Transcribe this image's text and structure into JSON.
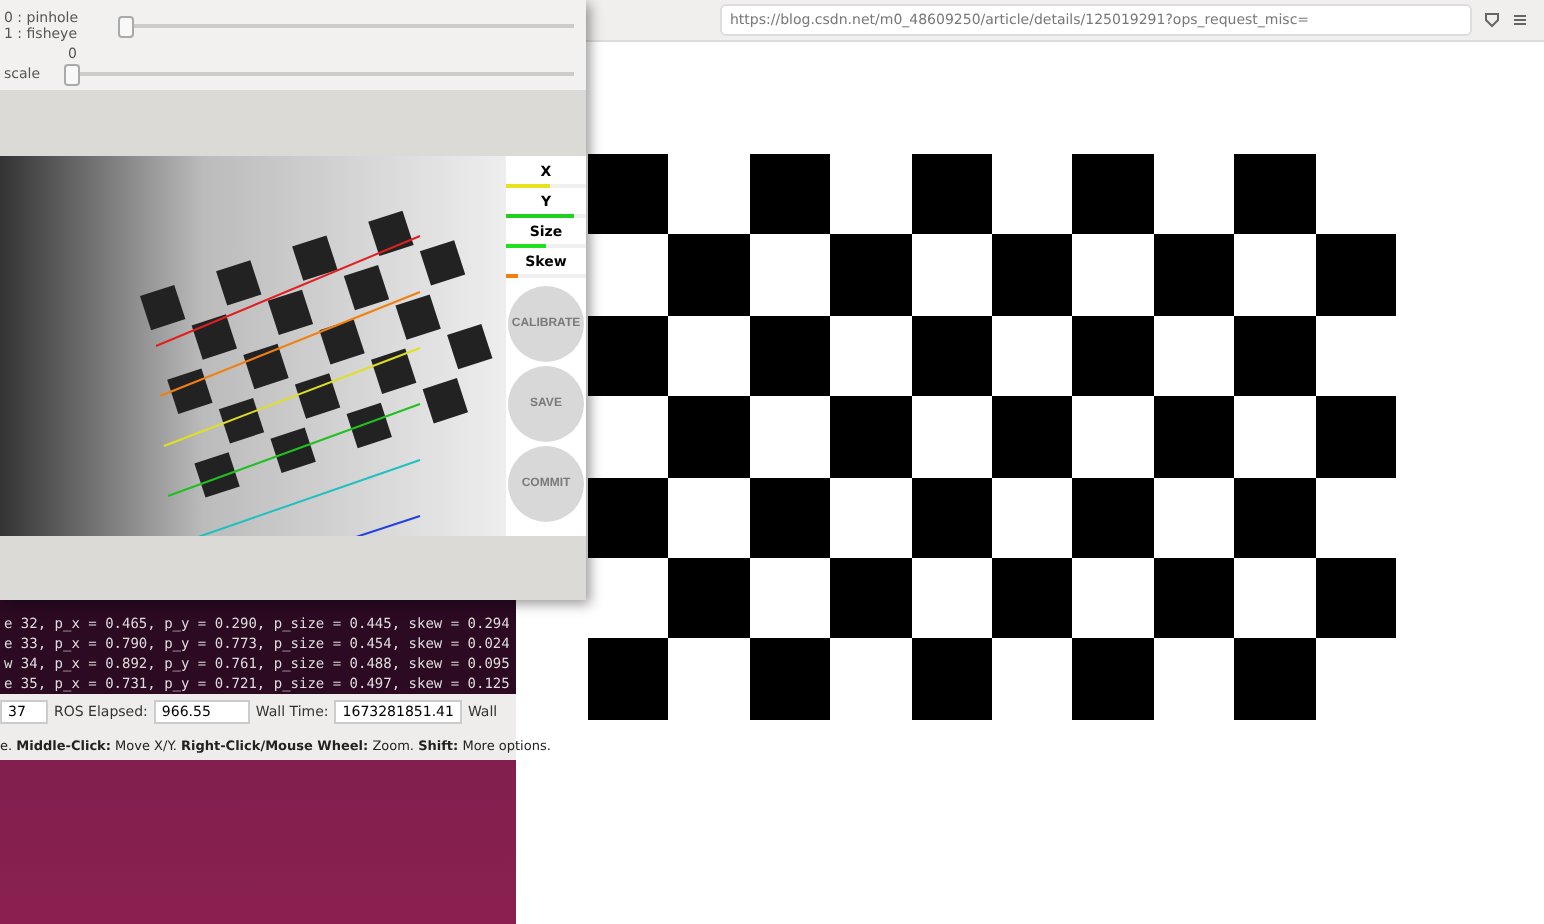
{
  "browser": {
    "url": "https://blog.csdn.net/m0_48609250/article/details/125019291?ops_request_misc="
  },
  "terminal": {
    "lines": [
      "e 32, p_x = 0.465, p_y = 0.290, p_size = 0.445, skew = 0.294",
      "e 33, p_x = 0.790, p_y = 0.773, p_size = 0.454, skew = 0.024",
      "w 34, p_x = 0.892, p_y = 0.761, p_size = 0.488, skew = 0.095",
      "e 35, p_x = 0.731, p_y = 0.721, p_size = 0.497, skew = 0.125"
    ],
    "status": [
      {
        "kind": "field",
        "value": "37"
      },
      {
        "kind": "label",
        "text": "ROS Elapsed:"
      },
      {
        "kind": "field",
        "value": "966.55"
      },
      {
        "kind": "label",
        "text": "Wall Time:"
      },
      {
        "kind": "field",
        "value": "1673281851.41"
      },
      {
        "kind": "label",
        "text": "Wall"
      }
    ],
    "hint": "e. **Middle-Click:** Move X/Y. **Right-Click/Mouse Wheel:** Zoom. **Shift:** More options."
  },
  "calibrator": {
    "model": {
      "options": [
        "0 : pinhole",
        "1 : fisheye"
      ],
      "level": 0
    },
    "scale": {
      "label": "scale",
      "value": "0",
      "level": 0
    },
    "progress": [
      {
        "label": "X",
        "level": 0.55,
        "color": "#e8e020"
      },
      {
        "label": "Y",
        "level": 0.85,
        "color": "#20d020"
      },
      {
        "label": "Size",
        "level": 0.5,
        "color": "#20e020"
      },
      {
        "label": "Skew",
        "level": 0.15,
        "color": "#f08010"
      }
    ],
    "buttons": [
      {
        "label": "CALIBRATE",
        "disabled": true
      },
      {
        "label": "SAVE",
        "disabled": true
      },
      {
        "label": "COMMIT",
        "disabled": true
      }
    ]
  }
}
